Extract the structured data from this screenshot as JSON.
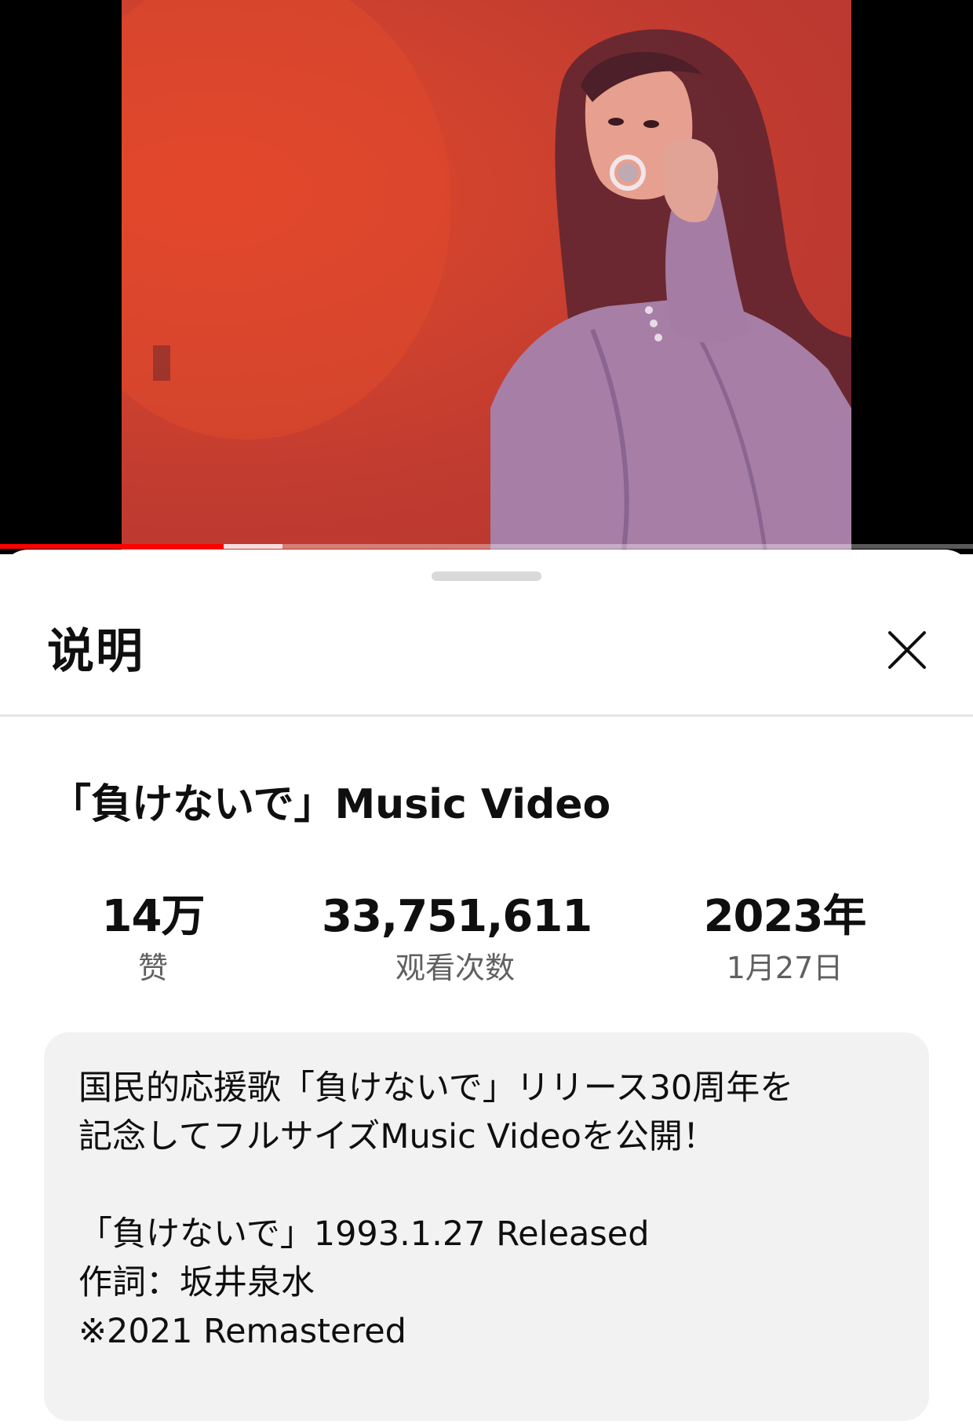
{
  "player": {
    "progress_played_fraction": 0.23,
    "progress_buffered_fraction": 0.29,
    "accent_color": "#ff0000"
  },
  "sheet": {
    "title": "说明",
    "close_icon": "close-icon"
  },
  "video": {
    "title": "「負けないで」Music Video"
  },
  "stats": {
    "likes_value": "14万",
    "likes_label": "赞",
    "views_value": "33,751,611",
    "views_label": "观看次数",
    "year_value": "2023年",
    "date_label": "1月27日"
  },
  "description": {
    "lines": [
      "国民的応援歌「負けないで」リリース30周年を",
      "記念してフルサイズMusic Videoを公開！",
      "",
      "「負けないで」1993.1.27 Released",
      "作詞：坂井泉水",
      "※2021 Remastered"
    ]
  }
}
